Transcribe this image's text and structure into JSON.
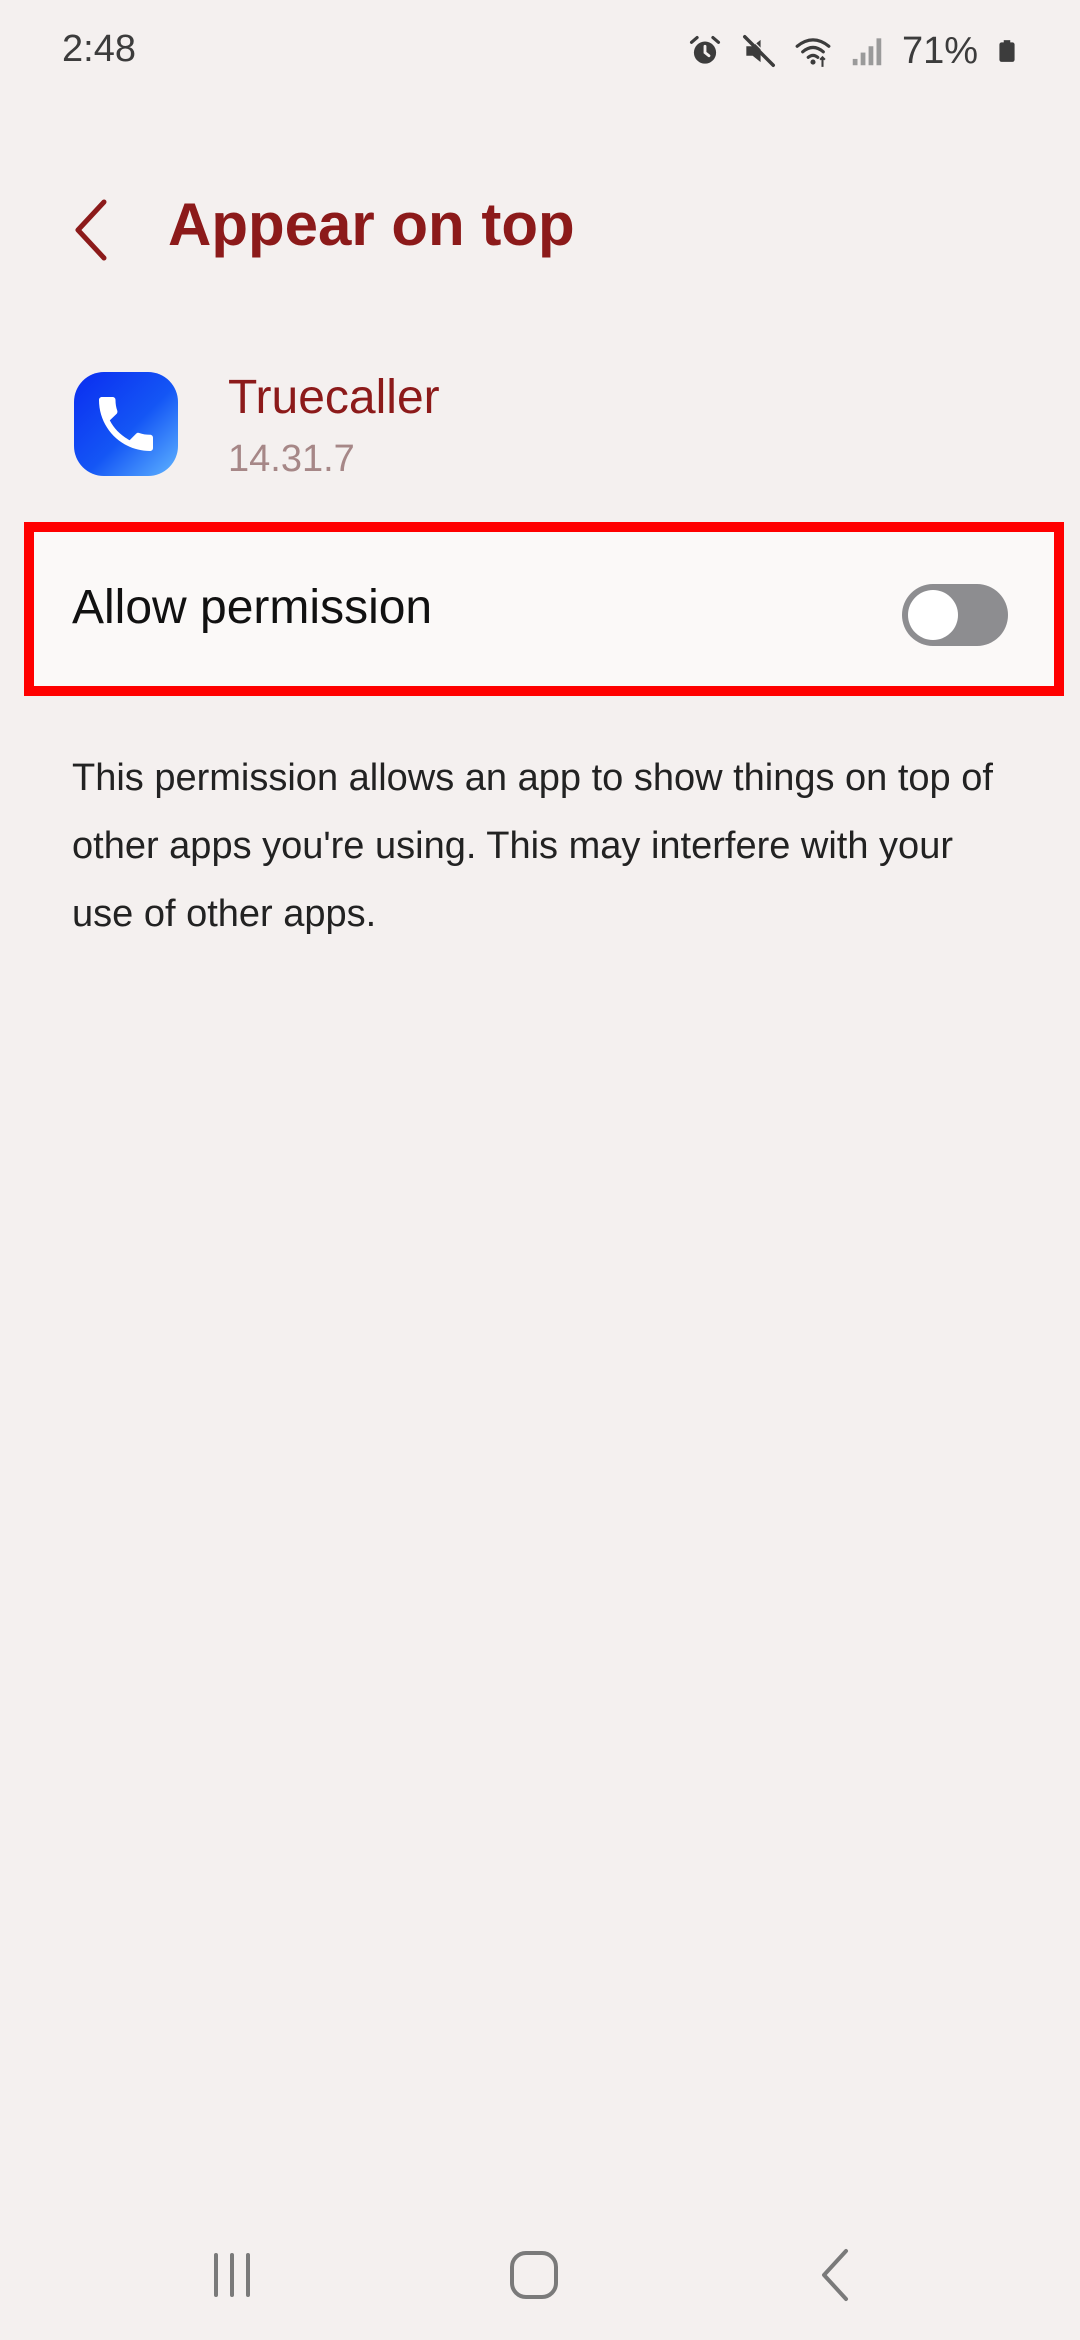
{
  "status_bar": {
    "time": "2:48",
    "battery_percent": "71%",
    "icons": [
      "alarm-icon",
      "mute-icon",
      "wifi-icon",
      "signal-icon",
      "battery-icon"
    ]
  },
  "header": {
    "back_icon": "chevron-left-icon",
    "title": "Appear on top"
  },
  "app": {
    "name": "Truecaller",
    "version": "14.31.7",
    "icon": "truecaller-app-icon",
    "icon_color": "#0a2cf0"
  },
  "permission": {
    "label": "Allow permission",
    "enabled": false,
    "highlight_color": "#ff0000"
  },
  "description": "This permission allows an app to show things on top of other apps you're using. This may interfere with your use of other apps.",
  "colors": {
    "accent": "#8c1a1a",
    "background": "#f4f0ef",
    "toggle_off": "#8d8d90"
  },
  "nav_bar": {
    "items": [
      "recent-apps-icon",
      "home-icon",
      "back-icon"
    ]
  }
}
